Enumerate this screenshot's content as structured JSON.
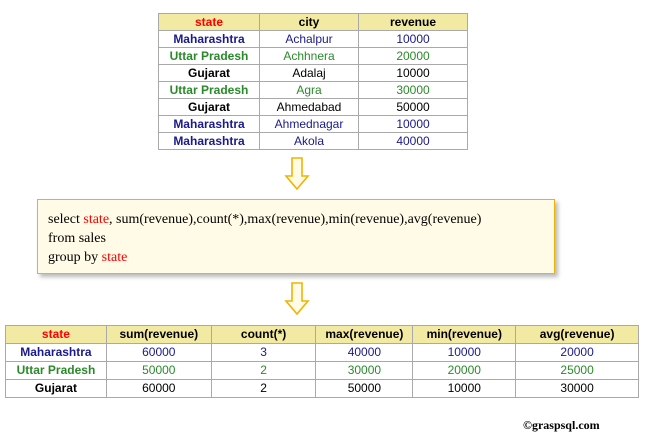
{
  "colors": {
    "maharashtra": "#1a1a8c",
    "uttar_pradesh": "#2a8a2a",
    "gujarat": "#000000",
    "header_bg": "#f2e9a2",
    "arrow_stroke": "#f0b400",
    "state_red": "#ff0000"
  },
  "source_table": {
    "headers": [
      "state",
      "city",
      "revenue"
    ],
    "rows": [
      {
        "state": "Maharashtra",
        "city": "Achalpur",
        "revenue": "10000",
        "color": "#1a1a8c"
      },
      {
        "state": "Uttar Pradesh",
        "city": "Achhnera",
        "revenue": "20000",
        "color": "#2a8a2a"
      },
      {
        "state": "Gujarat",
        "city": "Adalaj",
        "revenue": "10000",
        "color": "#000000"
      },
      {
        "state": "Uttar Pradesh",
        "city": "Agra",
        "revenue": "30000",
        "color": "#2a8a2a"
      },
      {
        "state": "Gujarat",
        "city": "Ahmedabad",
        "revenue": "50000",
        "color": "#000000"
      },
      {
        "state": "Maharashtra",
        "city": "Ahmednagar",
        "revenue": "10000",
        "color": "#1a1a8c"
      },
      {
        "state": "Maharashtra",
        "city": "Akola",
        "revenue": "40000",
        "color": "#1a1a8c"
      }
    ]
  },
  "query": {
    "line1_prefix": "select ",
    "line1_state": "state",
    "line1_rest": ", sum(revenue),count(*),max(revenue),min(revenue),avg(revenue)",
    "line2": "from sales",
    "line3_prefix": "group by ",
    "line3_state": "state"
  },
  "result_table": {
    "headers": [
      "state",
      "sum(revenue)",
      "count(*)",
      "max(revenue)",
      "min(revenue)",
      "avg(revenue)"
    ],
    "rows": [
      {
        "state": "Maharashtra",
        "sum": "60000",
        "count": "3",
        "max": "40000",
        "min": "10000",
        "avg": "20000",
        "color": "#1a1a8c"
      },
      {
        "state": "Uttar Pradesh",
        "sum": "50000",
        "count": "2",
        "max": "30000",
        "min": "20000",
        "avg": "25000",
        "color": "#2a8a2a"
      },
      {
        "state": "Gujarat",
        "sum": "60000",
        "count": "2",
        "max": "50000",
        "min": "10000",
        "avg": "30000",
        "color": "#000000"
      }
    ]
  },
  "credit": "©graspsql.com"
}
